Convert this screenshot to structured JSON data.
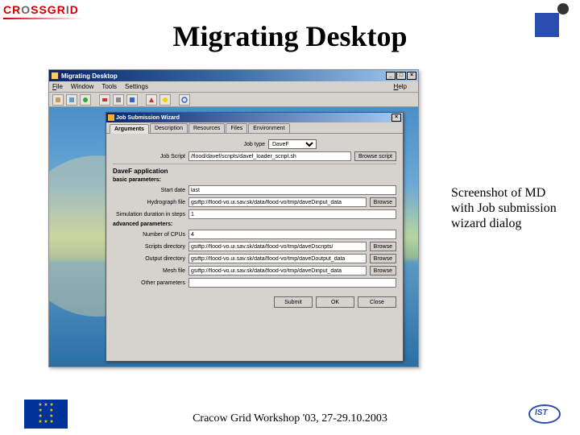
{
  "slide": {
    "title": "Migrating Desktop",
    "caption": "Screenshot of MD with Job submission wizard dialog",
    "footer": "Cracow Grid Workshop '03, 27-29.10.2003"
  },
  "logos": {
    "crossgrid_prefix": "CR",
    "crossgrid_mid": "O",
    "crossgrid_suffix": "SSGR",
    "crossgrid_end": "I",
    "crossgrid_last": "D",
    "ist": "IST"
  },
  "app": {
    "title": "Migrating Desktop",
    "menu": {
      "file": "File",
      "window": "Window",
      "tools": "Tools",
      "settings": "Settings",
      "help": "Help"
    },
    "winbtns": {
      "min": "_",
      "max": "□",
      "close": "×"
    }
  },
  "wizard": {
    "title": "Job Submission Wizard",
    "close_x": "×",
    "tabs": {
      "arguments": "Arguments",
      "description": "Description",
      "resources": "Resources",
      "files": "Files",
      "environment": "Environment"
    },
    "jobtype_label": "Job type",
    "jobtype_value": "DaveF",
    "jobscript_label": "Job Script",
    "jobscript_value": "/flood/davef/scripts/davef_loader_script.sh",
    "browse_script": "Browse script",
    "app_heading": "DaveF application",
    "basic_heading": "basic parameters:",
    "adv_heading": "advanced parameters:",
    "fields": {
      "start_date_label": "Start date",
      "start_date_value": "last",
      "hydrograph_label": "Hydrograph file",
      "hydrograph_value": "gsiftp://flood-vo.ui.sav.sk/data/flood-vo/tmp/daveDinput_data",
      "sim_label": "Simulation duration in steps",
      "sim_value": "1",
      "cpus_label": "Number of CPUs",
      "cpus_value": "4",
      "scripts_label": "Scripts directory",
      "scripts_value": "gsiftp://flood-vo.ui.sav.sk/data/flood-vo/tmp/daveDscripts/",
      "output_label": "Output directory",
      "output_value": "gsiftp://flood-vo.ui.sav.sk/data/flood-vo/tmp/daveDoutput_data",
      "mesh_label": "Mesh file",
      "mesh_value": "gsiftp://flood-vo.ui.sav.sk/data/flood-vo/tmp/daveDinput_data",
      "other_label": "Other parameters",
      "other_value": ""
    },
    "browse": "Browse",
    "buttons": {
      "submit": "Submit",
      "ok": "OK",
      "close": "Close"
    }
  }
}
